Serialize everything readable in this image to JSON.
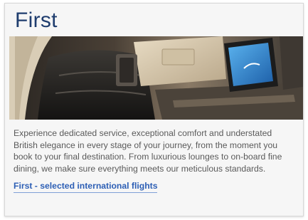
{
  "section": {
    "title": "First",
    "image_alt": "British Airways First cabin seat with seat-back screen",
    "description": "Experience dedicated service, exceptional comfort and understated British elegance in every stage of your journey, from the moment you book to your final destination. From luxurious lounges to on-board fine dining, we make sure everything meets our meticulous standards.",
    "link_label": "First - selected international flights"
  },
  "colors": {
    "title": "#1f3d6e",
    "link": "#2d5fb5",
    "body_text": "#5a5a5a",
    "card_background": "#f6f6f6"
  }
}
